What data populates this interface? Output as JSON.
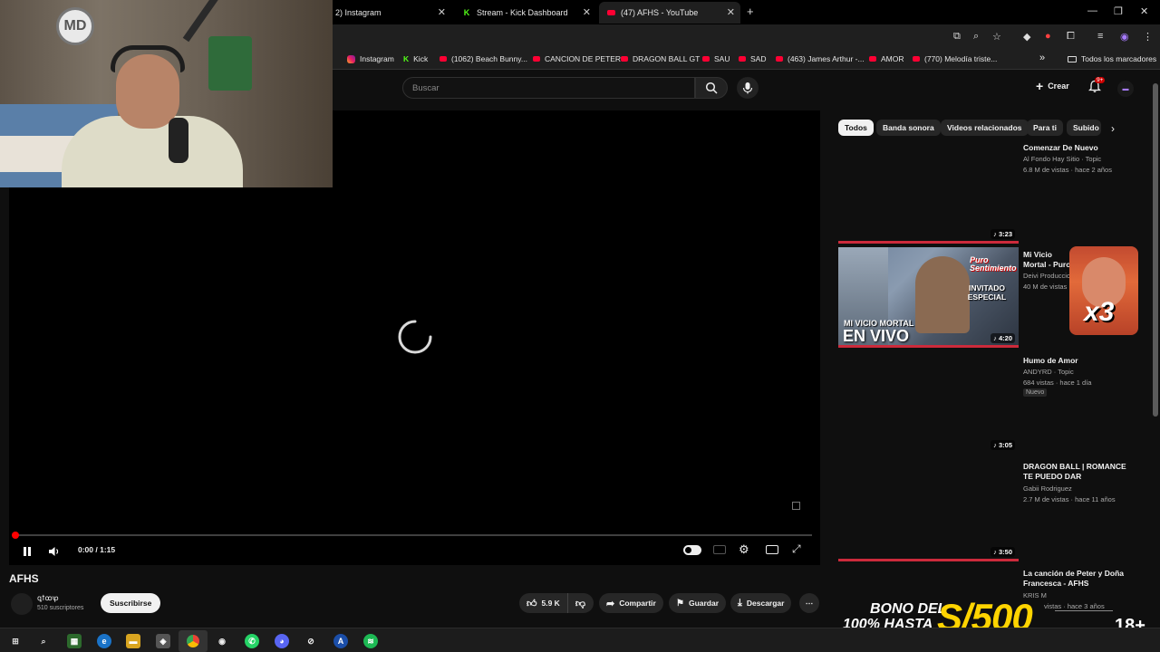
{
  "browser": {
    "tabs": [
      {
        "label": "2) Instagram"
      },
      {
        "label": "Stream - Kick Dashboard"
      },
      {
        "label": "(47) AFHS - YouTube"
      }
    ],
    "new_tab": "+",
    "bookmarks": [
      {
        "label": "Instagram"
      },
      {
        "label": "Kick"
      },
      {
        "label": "(1062) Beach Bunny..."
      },
      {
        "label": "CANCION DE PETER"
      },
      {
        "label": "DRAGON BALL GT"
      },
      {
        "label": "SAU"
      },
      {
        "label": "SAD"
      },
      {
        "label": "(463) James Arthur -..."
      },
      {
        "label": "AMOR"
      },
      {
        "label": "(770) Melodía triste..."
      }
    ],
    "bookmarks_overflow": "»",
    "all_bookmarks": "Todos los marcadores"
  },
  "youtube": {
    "search_placeholder": "Buscar",
    "create_label": "Crear",
    "notifications_badge": "9+",
    "player": {
      "time": "0:00 / 1:15",
      "progress": 0.0
    },
    "video": {
      "title": "AFHS",
      "channel": "ꝗꝉꝏꝕ",
      "subscribers": "510 suscriptores",
      "subscribe_label": "Suscribirse",
      "likes": "5.9 K",
      "share_label": "Compartir",
      "save_label": "Guardar",
      "download_label": "Descargar"
    },
    "chips": [
      "Todos",
      "Banda sonora",
      "Videos relacionados",
      "Para ti",
      "Subido"
    ],
    "related": [
      {
        "title": "Comenzar De Nuevo",
        "channel": "Al Fondo Hay Sitio · Topic",
        "meta": "6.8 M de vistas · hace 2 años",
        "duration": "3:23"
      },
      {
        "title": "Mi Vicio Mortal - Puro Sentimiento En Vivo",
        "channel": "Deivi Producciones",
        "meta": "40 M de vistas · hace",
        "duration": "4:20",
        "thumb_text_top": "Puro Sentimiento",
        "thumb_text_mid": "INVITADO ESPECIAL",
        "thumb_text_sub": "MI VICIO MORTAL",
        "thumb_text_big": "EN VIVO"
      },
      {
        "title": "Humo de Amor",
        "channel": "ANDYRD · Topic",
        "meta": "684 vistas · hace 1 día",
        "badge": "Nuevo",
        "duration": "3:05"
      },
      {
        "title": "DRAGON BALL | ROMANCE TE PUEDO DAR",
        "channel": "Gabii Rodriguez",
        "meta": "2.7 M de vistas · hace 11 años",
        "duration": "3:50"
      },
      {
        "title": "La canción de Peter y Doña Francesca - AFHS",
        "channel": "KRIS M",
        "meta": "vistas · hace 3 años"
      }
    ]
  },
  "overlay": {
    "reaction_text": "x3",
    "ad_line1": "BONO DEL",
    "ad_line2": "100% HASTA",
    "ad_amount": "S/500",
    "ad_age": "18+",
    "webcam_logo": "MD"
  },
  "colors": {
    "yt_red": "#ff0000",
    "bg": "#0f0f0f",
    "chip_bg": "#272727",
    "ad_yellow": "#ffd400"
  }
}
